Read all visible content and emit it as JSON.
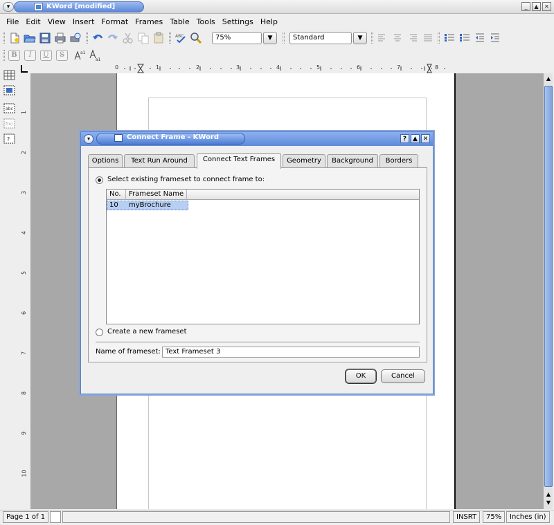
{
  "window": {
    "title": "KWord [modified]"
  },
  "menubar": {
    "items": [
      "File",
      "Edit",
      "View",
      "Insert",
      "Format",
      "Frames",
      "Table",
      "Tools",
      "Settings",
      "Help"
    ]
  },
  "toolbar": {
    "zoom": "75%",
    "style": "Standard"
  },
  "format_toolbar": {
    "bold": "B",
    "italic": "I",
    "underline": "U",
    "strike": "S"
  },
  "ruler": {
    "h_ticks": [
      "0",
      "1",
      "2",
      "3",
      "4",
      "5",
      "6",
      "7",
      "8"
    ],
    "v_ticks": [
      "1",
      "2",
      "3",
      "4",
      "5",
      "6",
      "7",
      "8",
      "9",
      "10"
    ]
  },
  "dialog": {
    "title": "Connect Frame - KWord",
    "tabs": [
      "Options",
      "Text Run Around",
      "Connect Text Frames",
      "Geometry",
      "Background",
      "Borders"
    ],
    "active_tab": "Connect Text Frames",
    "radio_existing": "Select existing frameset to connect frame to:",
    "list_columns": [
      "No.",
      "Frameset Name"
    ],
    "list_rows": [
      {
        "no": "10",
        "name": "myBrochure"
      }
    ],
    "radio_new": "Create a new frameset",
    "name_label": "Name of frameset:",
    "name_value": "Text Frameset 3",
    "ok_label": "OK",
    "cancel_label": "Cancel"
  },
  "statusbar": {
    "page": "Page 1 of 1",
    "mode": "INSRT",
    "zoom": "75%",
    "unit": "Inches (in)"
  },
  "colors": {
    "accent": "#5f89d9",
    "selection": "#b7cff3",
    "canvas": "#a8a8a8"
  }
}
